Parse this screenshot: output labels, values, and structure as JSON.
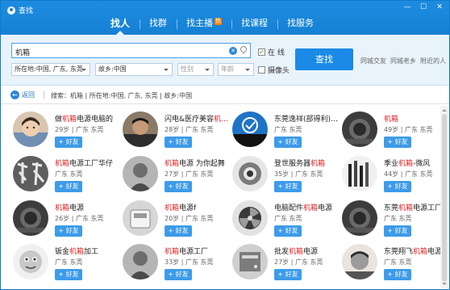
{
  "window": {
    "title": "查找",
    "controls": [
      "—",
      "☐",
      "✕"
    ]
  },
  "tabs": [
    {
      "label": "找人",
      "active": true
    },
    {
      "label": "找群"
    },
    {
      "label": "找主播",
      "badge": "热"
    },
    {
      "label": "找课程"
    },
    {
      "label": "找服务"
    }
  ],
  "search": {
    "query": "机箱",
    "online_label": "在 线",
    "online_checked": true,
    "webcam_label": "摄像头",
    "webcam_checked": false,
    "location": "所在地:中国, 广东, 东莞",
    "hometown": "故乡:中国",
    "gender": "性别",
    "age": "年龄",
    "find_button": "查找",
    "links": [
      "同城交友",
      "同城老乡",
      "附近的人"
    ]
  },
  "breadcrumb": {
    "back_label": "返回",
    "text": "搜索：机箱 | 所在地:中国, 广东, 东莞 | 故乡:中国"
  },
  "results": [
    {
      "pre": "做",
      "hl": "机箱",
      "post": "电源电脑的",
      "meta": "29岁 | 广东 东莞",
      "add": "+ 好友",
      "avatar": "photo-girl"
    },
    {
      "pre": "闪电&医疗美容",
      "hl": "机…",
      "post": "",
      "meta": "28岁 | 广东 东莞",
      "add": "+ 好友",
      "avatar": "photo-man"
    },
    {
      "pre": "东莞逸祥(部得利)…",
      "hl": "",
      "post": "",
      "meta": "广东 东莞",
      "add": "+ 好友",
      "avatar": "logo-blue"
    },
    {
      "pre": "",
      "hl": "机箱",
      "post": "",
      "meta": "49岁 | 广东 东莞",
      "add": "+ 好友",
      "avatar": "gray-dark"
    },
    {
      "pre": "",
      "hl": "机箱",
      "post": "电源工厂华仔",
      "meta": "广东 东莞",
      "add": "+ 好友",
      "avatar": "calligraphy"
    },
    {
      "pre": "",
      "hl": "机箱",
      "post": "电源 为你起舞",
      "meta": "27岁 | 广东 东莞",
      "add": "+ 好友",
      "avatar": "gray-mid"
    },
    {
      "pre": "登世服务器",
      "hl": "机箱",
      "post": "",
      "meta": "35岁 | 广东 东莞",
      "add": "+ 好友",
      "avatar": "gray-ring"
    },
    {
      "pre": "季业",
      "hl": "机箱",
      "post": "-微风",
      "meta": "44岁 | 广东 东莞",
      "add": "+ 好友",
      "avatar": "gray-stripes"
    },
    {
      "pre": "",
      "hl": "机箱",
      "post": "电源",
      "meta": "26岁 | 广东 东莞",
      "add": "+ 好友",
      "avatar": "gray-dark"
    },
    {
      "pre": "",
      "hl": "机箱",
      "post": "电源f",
      "meta": "20岁 | 广东 东莞",
      "add": "+ 好友",
      "avatar": "gray-light"
    },
    {
      "pre": "电脑配件",
      "hl": "机箱",
      "post": "电源",
      "meta": "广东 东莞",
      "add": "+ 好友",
      "avatar": "gray-fan"
    },
    {
      "pre": "东莞",
      "hl": "机箱",
      "post": "电源工厂…",
      "meta": "广东 东莞",
      "add": "+ 好友",
      "avatar": "gray-dark"
    },
    {
      "pre": "钣金",
      "hl": "机箱",
      "post": "加工",
      "meta": "广东 东莞",
      "add": "+ 好友",
      "avatar": "mascot"
    },
    {
      "pre": "",
      "hl": "机箱",
      "post": "电源工厂",
      "meta": "33岁 | 广东 东莞",
      "add": "+ 好友",
      "avatar": "gray-mid"
    },
    {
      "pre": "批发",
      "hl": "机箱",
      "post": "电源",
      "meta": "27岁 | 广东 东莞",
      "add": "+ 好友",
      "avatar": "gray-box"
    },
    {
      "pre": "东莞翔飞",
      "hl": "机箱",
      "post": "电源",
      "meta": "广东 东莞",
      "add": "+ 好友",
      "avatar": "photo-child"
    }
  ],
  "colors": {
    "header": "#1581d4",
    "accent": "#1a8ae6",
    "highlight": "#e02020",
    "panel": "#e9f3fb"
  }
}
